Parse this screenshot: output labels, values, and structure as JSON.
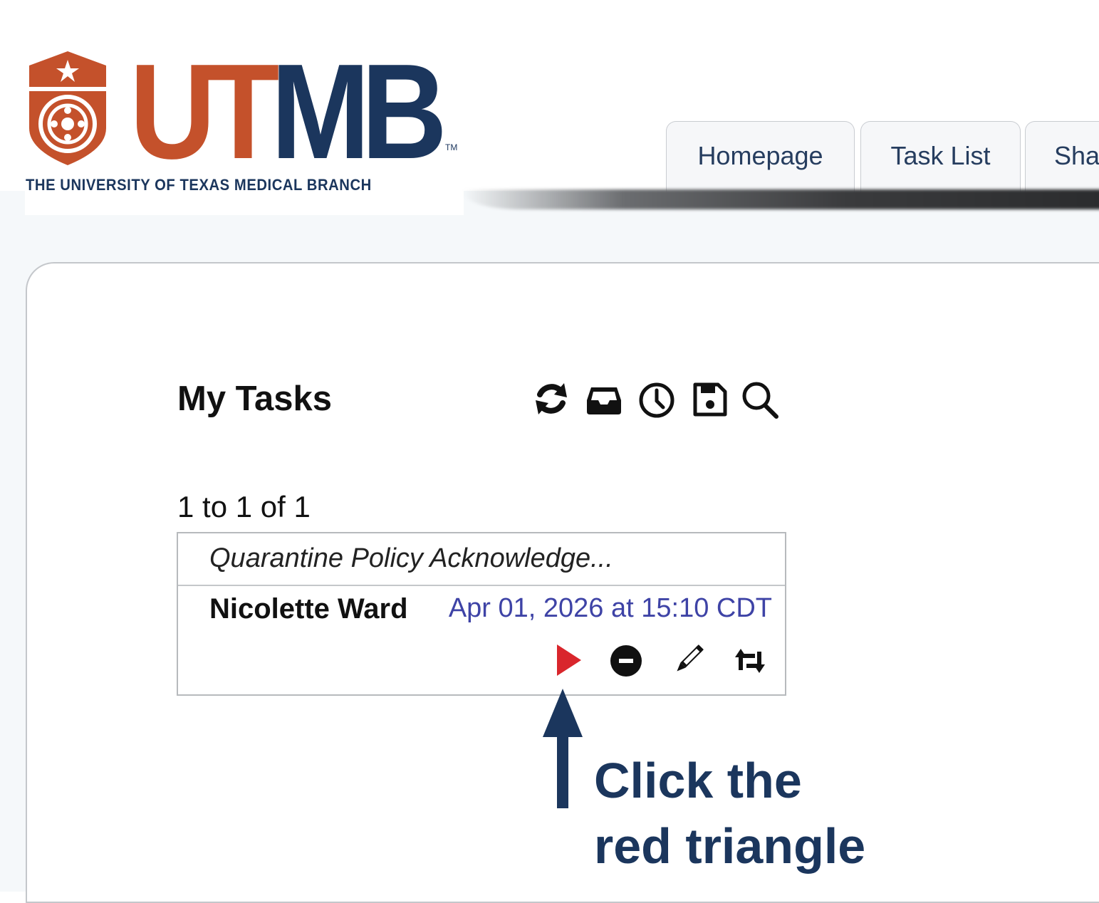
{
  "logo": {
    "wordmark_ut": "UT",
    "wordmark_mb": "MB",
    "trademark": "TM",
    "tagline": "THE UNIVERSITY OF TEXAS MEDICAL BRANCH",
    "colors": {
      "orange": "#c4512b",
      "navy": "#1b365d"
    }
  },
  "tabs": [
    {
      "label": "Homepage"
    },
    {
      "label": "Task List"
    },
    {
      "label": "Sha"
    }
  ],
  "tasks_panel": {
    "title": "My Tasks",
    "toolbar_icons": [
      "refresh-icon",
      "inbox-icon",
      "clock-icon",
      "save-icon",
      "search-icon"
    ],
    "pager": "1 to 1 of 1",
    "task": {
      "title": "Quarantine Policy Acknowledge...",
      "assignee": "Nicolette Ward",
      "due": "Apr 01, 2026 at 15:10 CDT",
      "actions": [
        "play-icon",
        "remove-icon",
        "pencil-icon",
        "reassign-icon"
      ],
      "action_colors": {
        "play": "#d9262c",
        "date": "#3e43a6"
      }
    }
  },
  "callout": {
    "line1": "Click the",
    "line2": "red triangle"
  }
}
